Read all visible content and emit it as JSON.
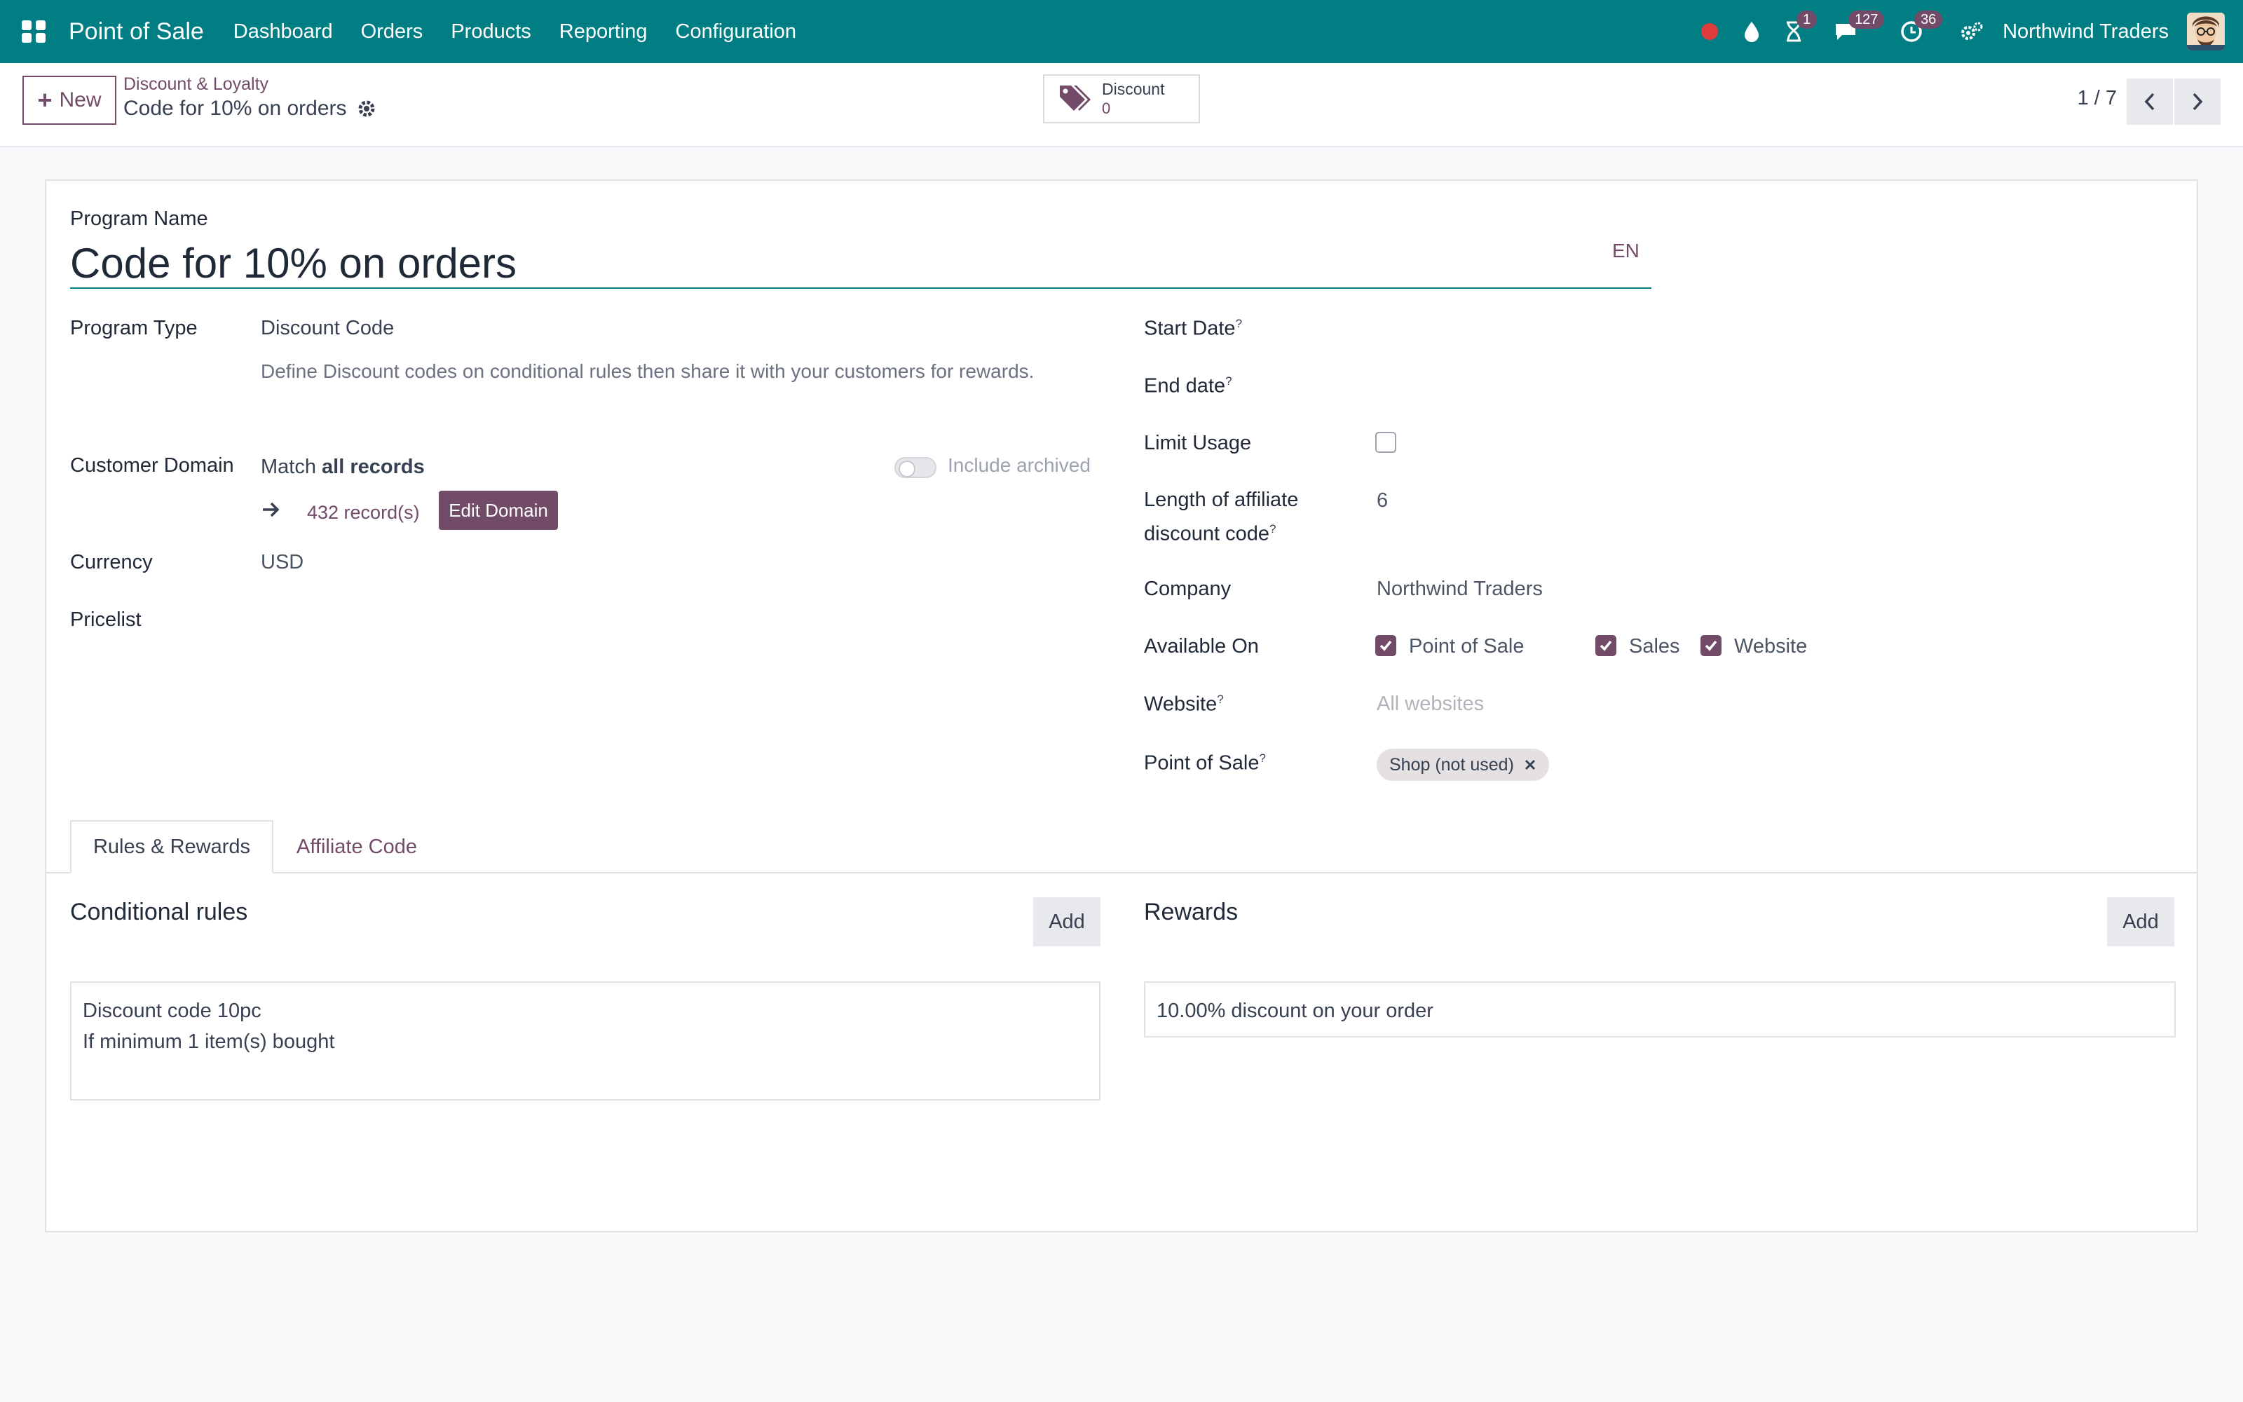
{
  "navbar": {
    "app_name": "Point of Sale",
    "menu": [
      "Dashboard",
      "Orders",
      "Products",
      "Reporting",
      "Configuration"
    ],
    "badges": {
      "activities": "1",
      "messages": "127",
      "timesheet": "36"
    },
    "company": "Northwind Traders",
    "status_color": "#e03c3c",
    "brand_color": "#017e84"
  },
  "control": {
    "new_label": "New",
    "breadcrumb": "Discount & Loyalty",
    "record_title": "Code for 10% on orders",
    "stat_label": "Discount",
    "stat_value": "0",
    "pager": "1 / 7"
  },
  "form": {
    "program_name_label": "Program Name",
    "program_name": "Code for 10% on orders",
    "lang": "EN",
    "program_type_label": "Program Type",
    "program_type": "Discount Code",
    "program_type_desc": "Define Discount codes on conditional rules then share it with your customers for rewards.",
    "customer_domain_label": "Customer Domain",
    "match_prefix": "Match",
    "match_bold": "all records",
    "include_archived": "Include archived",
    "records_count": "432 record(s)",
    "edit_domain": "Edit Domain",
    "currency_label": "Currency",
    "currency": "USD",
    "pricelist_label": "Pricelist",
    "start_date_label": "Start Date",
    "end_date_label": "End date",
    "limit_usage_label": "Limit Usage",
    "code_length_label_1": "Length of affiliate",
    "code_length_label_2": "discount code",
    "code_length": "6",
    "company_label": "Company",
    "company": "Northwind Traders",
    "available_on_label": "Available On",
    "available_on": [
      "Point of Sale",
      "Sales",
      "Website"
    ],
    "website_label": "Website",
    "website_placeholder": "All websites",
    "pos_label": "Point of Sale",
    "pos_tag": "Shop (not used)",
    "help_mark": "?"
  },
  "tabs": [
    "Rules & Rewards",
    "Affiliate Code"
  ],
  "rules": {
    "title": "Conditional rules",
    "add": "Add",
    "items": [
      {
        "line1": "Discount code 10pc",
        "line2": "If minimum 1 item(s) bought"
      }
    ]
  },
  "rewards": {
    "title": "Rewards",
    "add": "Add",
    "items": [
      {
        "line1": "10.00% discount on your order"
      }
    ]
  }
}
